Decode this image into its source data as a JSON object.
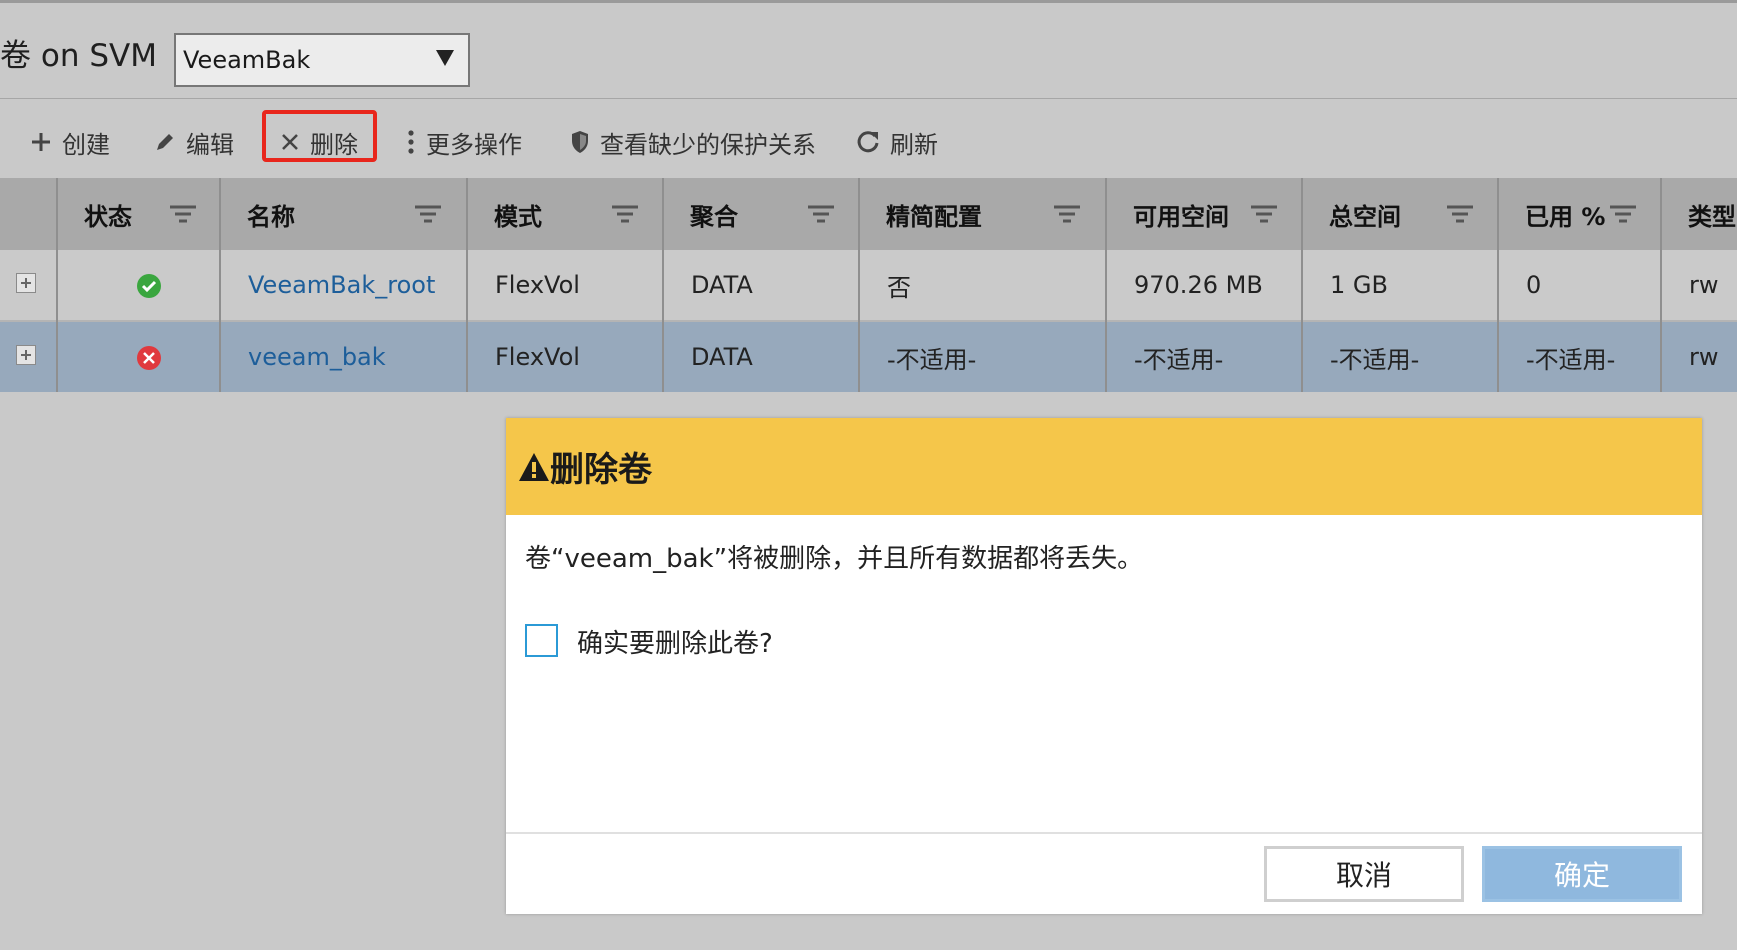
{
  "header": {
    "title": "卷 on SVM",
    "svm_select_value": "VeeamBak"
  },
  "toolbar": {
    "create": "创建",
    "edit": "编辑",
    "delete": "删除",
    "more_actions": "更多操作",
    "view_missing_protection": "查看缺少的保护关系",
    "refresh": "刷新"
  },
  "table": {
    "columns": [
      "状态",
      "名称",
      "模式",
      "聚合",
      "精简配置",
      "可用空间",
      "总空间",
      "已用 %",
      "类型"
    ],
    "rows": [
      {
        "status": "ok",
        "name": "VeeamBak_root",
        "mode": "FlexVol",
        "aggregate": "DATA",
        "thin": "否",
        "available": "970.26 MB",
        "total": "1 GB",
        "used_pct": "0",
        "type": "rw"
      },
      {
        "status": "error",
        "name": "veeam_bak",
        "mode": "FlexVol",
        "aggregate": "DATA",
        "thin": "-不适用-",
        "available": "-不适用-",
        "total": "-不适用-",
        "used_pct": "-不适用-",
        "type": "rw"
      }
    ]
  },
  "dialog": {
    "title": "删除卷",
    "message": "卷“veeam_bak”将被删除，并且所有数据都将丢失。",
    "checkbox_label": "确实要删除此卷?",
    "cancel_label": "取消",
    "ok_label": "确定"
  },
  "colors": {
    "dialog_header": "#f5c64a",
    "highlight_box": "#e8261c",
    "selected_row": "#97a9bc",
    "ok_button": "#8fb8de",
    "link": "#1d5e9a"
  },
  "icons": [
    "plus-icon",
    "pencil-icon",
    "close-icon",
    "more-vertical-icon",
    "shield-icon",
    "refresh-icon",
    "filter-icon",
    "check-circle-icon",
    "error-circle-icon",
    "warning-icon",
    "chevron-down-icon"
  ]
}
